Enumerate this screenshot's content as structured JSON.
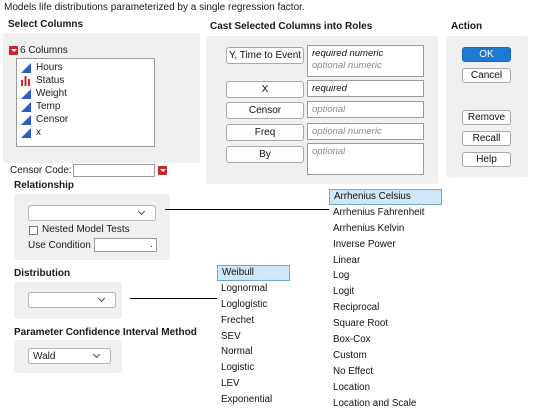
{
  "description": "Models life distributions parameterized by a single regression factor.",
  "select_columns": {
    "title": "Select Columns",
    "count_label": "6 Columns",
    "columns": [
      {
        "name": "Hours",
        "icon": "continuous-icon"
      },
      {
        "name": "Status",
        "icon": "nominal-icon"
      },
      {
        "name": "Weight",
        "icon": "continuous-icon"
      },
      {
        "name": "Temp",
        "icon": "continuous-icon"
      },
      {
        "name": "Censor",
        "icon": "continuous-icon"
      },
      {
        "name": "x",
        "icon": "continuous-icon"
      }
    ]
  },
  "roles": {
    "title": "Cast Selected Columns into Roles",
    "items": [
      {
        "button": "Y, Time to Event",
        "lines": [
          "required numeric",
          "optional numeric"
        ]
      },
      {
        "button": "X",
        "lines": [
          "required"
        ]
      },
      {
        "button": "Censor",
        "lines": [
          "optional"
        ]
      },
      {
        "button": "Freq",
        "lines": [
          "optional numeric"
        ]
      },
      {
        "button": "By",
        "lines": [
          "optional"
        ]
      }
    ]
  },
  "action": {
    "title": "Action",
    "buttons": [
      "OK",
      "Cancel",
      "Remove",
      "Recall",
      "Help"
    ]
  },
  "censor_code": {
    "label": "Censor Code:",
    "value": ""
  },
  "relationship": {
    "title": "Relationship",
    "selected": "",
    "nested_label": "Nested Model Tests",
    "use_condition_label": "Use Condition",
    "use_condition_value": ".",
    "options": [
      "Arrhenius Celsius",
      "Arrhenius Fahrenheit",
      "Arrhenius Kelvin",
      "Inverse Power",
      "Linear",
      "Log",
      "Logit",
      "Reciprocal",
      "Square Root",
      "Box-Cox",
      "Custom",
      "No Effect",
      "Location",
      "Location and Scale"
    ],
    "highlighted": "Arrhenius Celsius"
  },
  "distribution": {
    "title": "Distribution",
    "selected": "",
    "options": [
      "Weibull",
      "Lognormal",
      "Loglogistic",
      "Frechet",
      "SEV",
      "Normal",
      "Logistic",
      "LEV",
      "Exponential"
    ],
    "highlighted": "Weibull"
  },
  "ci_method": {
    "title": "Parameter Confidence Interval Method",
    "selected": "Wald"
  },
  "colors": {
    "accent": "#1f78d1",
    "highlight": "#cfe6f7",
    "red_caret": "#c9262c",
    "continuous_icon": "#2b5fc4",
    "nominal_icon": "#c9262c"
  }
}
